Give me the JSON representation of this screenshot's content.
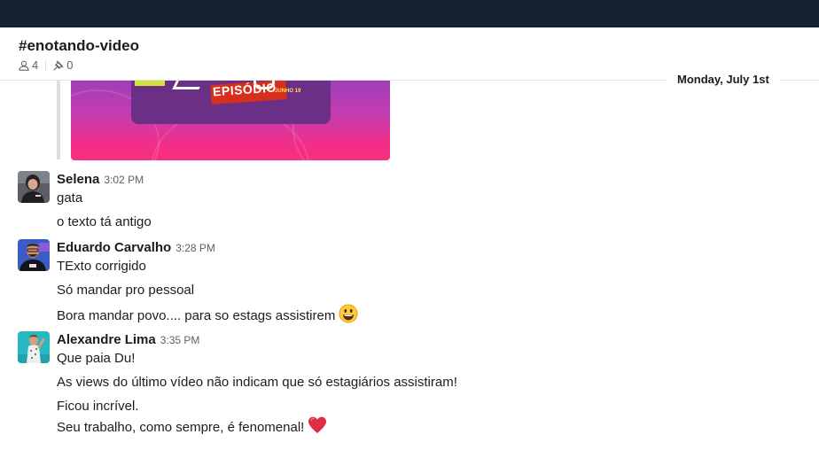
{
  "channel": {
    "name": "#enotando-video",
    "members_count": "4",
    "pinned_count": "0"
  },
  "date_divider": "Monday, July 1st",
  "attachment": {
    "episode_text": "EPISÓDIO",
    "date_text": "JUNHO 19"
  },
  "messages": [
    {
      "sender": "Selena",
      "time": "3:02 PM",
      "lines": [
        "gata",
        "o texto tá antigo"
      ]
    },
    {
      "sender": "Eduardo Carvalho",
      "time": "3:28 PM",
      "lines": [
        "TExto corrigido",
        "Só mandar pro pessoal",
        "Bora mandar povo.... para so estags assistirem"
      ],
      "emoji_icon": "smiley-emoji-icon"
    },
    {
      "sender": "Alexandre Lima",
      "time": "3:35 PM",
      "lines": [
        "Que paia Du!",
        "As views do último vídeo não indicam que só estagiários assistiram!",
        "Ficou incrível.",
        "Seu trabalho, como sempre, é fenomenal!"
      ],
      "emoji_icon": "red-heart-emoji-icon"
    }
  ],
  "colors": {
    "topbar": "#14202f",
    "text": "#1d1c1d",
    "muted": "#616061"
  }
}
